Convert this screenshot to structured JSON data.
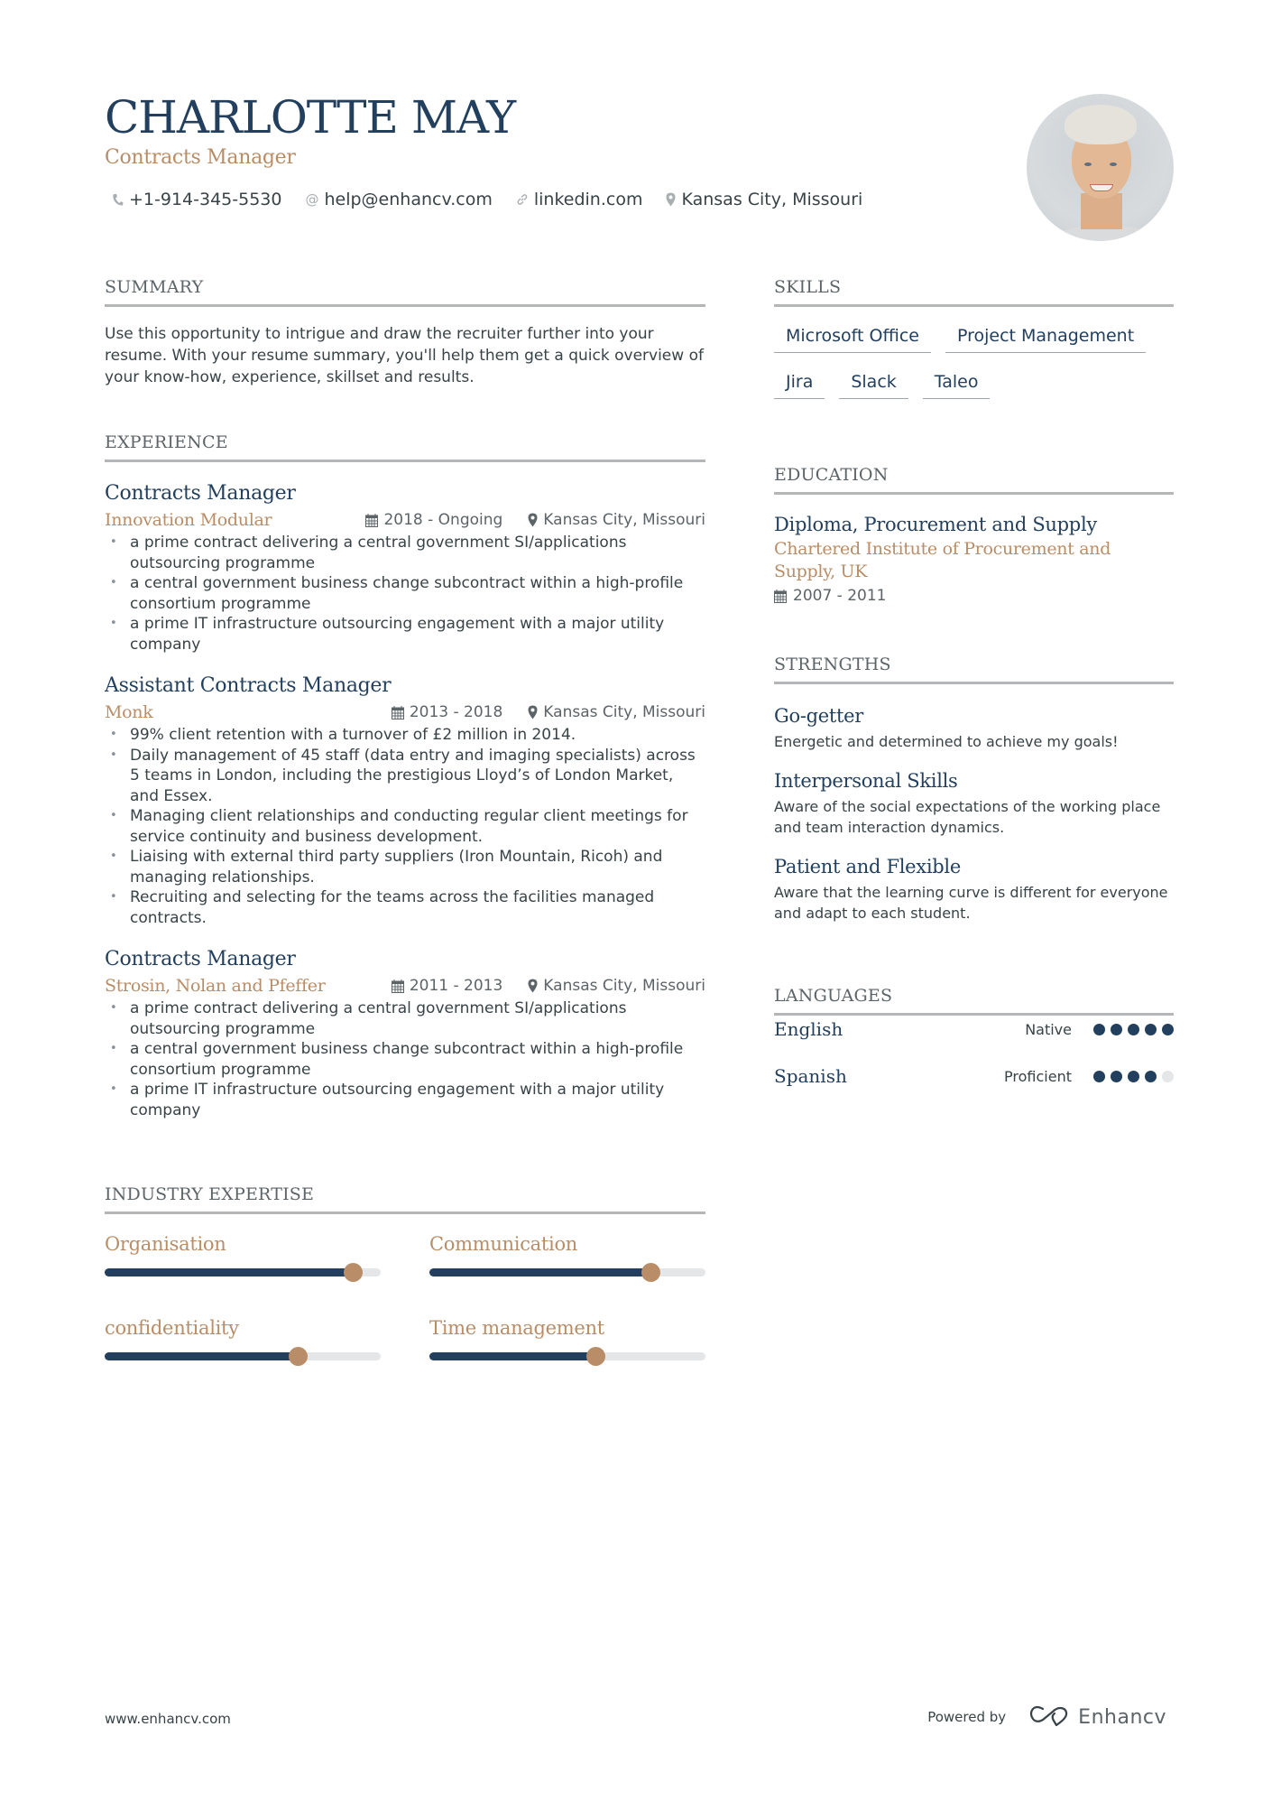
{
  "header": {
    "name": "CHARLOTTE MAY",
    "title": "Contracts Manager",
    "contacts": [
      {
        "icon": "phone-icon",
        "text": "+1-914-345-5530"
      },
      {
        "icon": "at-icon",
        "text": "help@enhancv.com"
      },
      {
        "icon": "link-icon",
        "text": "linkedin.com"
      },
      {
        "icon": "location-icon",
        "text": "Kansas City, Missouri"
      }
    ],
    "photo_alt": "Profile photo"
  },
  "summary": {
    "heading": "SUMMARY",
    "text": "Use this opportunity to intrigue and draw the recruiter further into your resume. With your resume summary, you'll help them get a quick overview of your know-how, experience, skillset and results."
  },
  "experience": {
    "heading": "EXPERIENCE",
    "jobs": [
      {
        "title": "Contracts Manager",
        "company": "Innovation Modular",
        "dates": "2018 - Ongoing",
        "location": "Kansas City, Missouri",
        "bullets": [
          "a prime contract delivering a central government SI/applications outsourcing programme",
          "a central government business change subcontract within a high-profile consortium programme",
          "a prime IT infrastructure outsourcing engagement with a major utility company"
        ]
      },
      {
        "title": "Assistant Contracts Manager",
        "company": "Monk",
        "dates": "2013 - 2018",
        "location": "Kansas City, Missouri",
        "bullets": [
          "99% client retention with a turnover of £2 million in 2014.",
          "Daily management of 45 staff (data entry and imaging specialists) across 5 teams in London, including the prestigious Lloyd’s of London Market, and Essex.",
          "Managing client relationships and conducting regular client meetings for service continuity and business development.",
          "Liaising with external third party suppliers (Iron Mountain, Ricoh) and managing relationships.",
          "Recruiting and selecting for the teams across the facilities managed contracts."
        ]
      },
      {
        "title": "Contracts Manager",
        "company": "Strosin, Nolan and Pfeffer",
        "dates": "2011 - 2013",
        "location": "Kansas City, Missouri",
        "bullets": [
          "a prime contract delivering a central government SI/applications outsourcing programme",
          "a central government business change subcontract within a high-profile consortium programme",
          "a prime IT infrastructure outsourcing engagement with a major utility company"
        ]
      }
    ]
  },
  "expertise": {
    "heading": "INDUSTRY EXPERTISE",
    "items": [
      {
        "label": "Organisation",
        "level": 0.9
      },
      {
        "label": "Communication",
        "level": 0.8
      },
      {
        "label": "confidentiality",
        "level": 0.7
      },
      {
        "label": "Time management",
        "level": 0.6
      }
    ]
  },
  "skills": {
    "heading": "SKILLS",
    "tags": [
      "Microsoft Office",
      "Project Management",
      "Jira",
      "Slack",
      "Taleo"
    ]
  },
  "education": {
    "heading": "EDUCATION",
    "degree": "Diploma, Procurement and Supply",
    "school": "Chartered Institute of Procurement and Supply, UK",
    "dates": "2007 - 2011"
  },
  "strengths": {
    "heading": "STRENGTHS",
    "items": [
      {
        "title": "Go-getter",
        "desc": "Energetic and determined to achieve my goals!"
      },
      {
        "title": "Interpersonal Skills",
        "desc": "Aware of the social expectations of the working place and team interaction dynamics."
      },
      {
        "title": "Patient and Flexible",
        "desc": "Aware that the learning curve is different for everyone and adapt to each student."
      }
    ]
  },
  "languages": {
    "heading": "LANGUAGES",
    "items": [
      {
        "name": "English",
        "level": "Native",
        "rating": 5,
        "max": 5
      },
      {
        "name": "Spanish",
        "level": "Proficient",
        "rating": 4,
        "max": 5
      }
    ]
  },
  "footer": {
    "website": "www.enhancv.com",
    "powered_by": "Powered by",
    "brand": "Enhancv"
  },
  "colors": {
    "primary": "#223f5e",
    "accent": "#b88d67",
    "track": "#e5e6e8",
    "rule": "#b4b6b8"
  }
}
